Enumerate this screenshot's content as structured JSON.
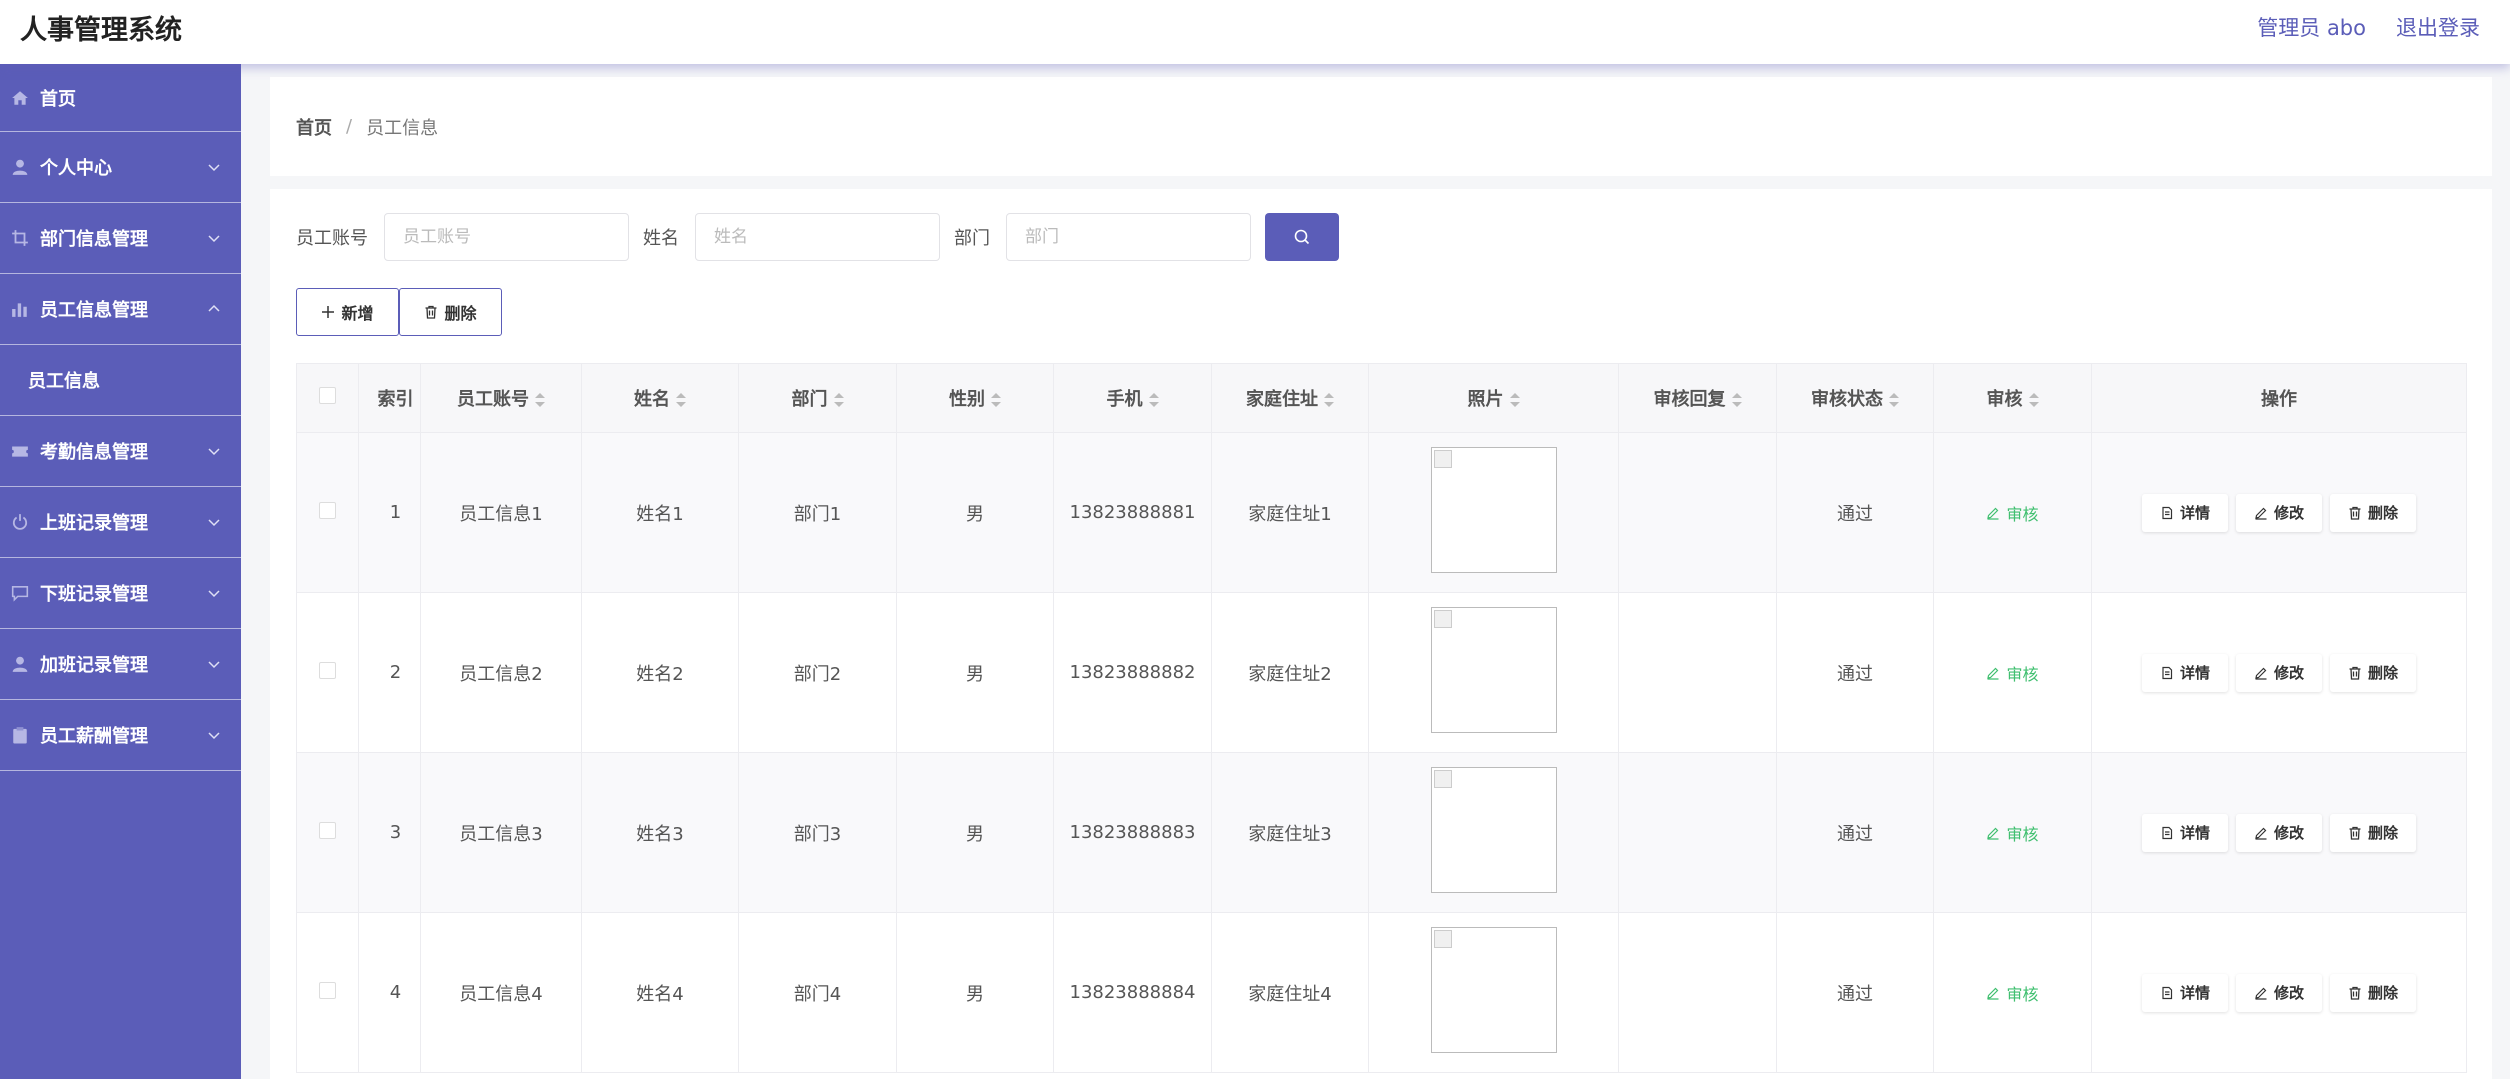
{
  "app": {
    "title": "人事管理系统"
  },
  "header": {
    "admin_label": "管理员 abo",
    "logout_label": "退出登录"
  },
  "sidebar": {
    "items": [
      {
        "label": "首页",
        "icon": "home-icon"
      },
      {
        "label": "个人中心",
        "icon": "user-icon"
      },
      {
        "label": "部门信息管理",
        "icon": "crop-icon"
      },
      {
        "label": "员工信息管理",
        "icon": "bar-chart-icon",
        "expanded": true
      },
      {
        "label": "考勤信息管理",
        "icon": "ticket-icon"
      },
      {
        "label": "上班记录管理",
        "icon": "power-icon"
      },
      {
        "label": "下班记录管理",
        "icon": "chat-icon"
      },
      {
        "label": "加班记录管理",
        "icon": "user-icon"
      },
      {
        "label": "员工薪酬管理",
        "icon": "clipboard-icon"
      }
    ],
    "sub_items": [
      {
        "label": "员工信息"
      }
    ]
  },
  "breadcrumb": {
    "home": "首页",
    "separator": "/",
    "current": "员工信息"
  },
  "search": {
    "account_label": "员工账号",
    "account_placeholder": "员工账号",
    "name_label": "姓名",
    "name_placeholder": "姓名",
    "dept_label": "部门",
    "dept_placeholder": "部门"
  },
  "toolbar": {
    "add_label": "新增",
    "delete_label": "删除"
  },
  "table": {
    "headers": [
      "索引",
      "员工账号",
      "姓名",
      "部门",
      "性别",
      "手机",
      "家庭住址",
      "照片",
      "审核回复",
      "审核状态",
      "审核",
      "操作"
    ],
    "rows": [
      {
        "index": "1",
        "account": "员工信息1",
        "name": "姓名1",
        "dept": "部门1",
        "gender": "男",
        "phone": "13823888881",
        "address": "家庭住址1",
        "reply": "",
        "status": "通过"
      },
      {
        "index": "2",
        "account": "员工信息2",
        "name": "姓名2",
        "dept": "部门2",
        "gender": "男",
        "phone": "13823888882",
        "address": "家庭住址2",
        "reply": "",
        "status": "通过"
      },
      {
        "index": "3",
        "account": "员工信息3",
        "name": "姓名3",
        "dept": "部门3",
        "gender": "男",
        "phone": "13823888883",
        "address": "家庭住址3",
        "reply": "",
        "status": "通过"
      },
      {
        "index": "4",
        "account": "员工信息4",
        "name": "姓名4",
        "dept": "部门4",
        "gender": "男",
        "phone": "13823888884",
        "address": "家庭住址4",
        "reply": "",
        "status": "通过"
      }
    ],
    "audit_label": "审核",
    "ops": {
      "detail": "详情",
      "edit": "修改",
      "delete": "删除"
    }
  },
  "colors": {
    "accent": "#5b5db8",
    "audit_green": "#3fbf6f",
    "sidebar_bg": "#5b5db8"
  }
}
